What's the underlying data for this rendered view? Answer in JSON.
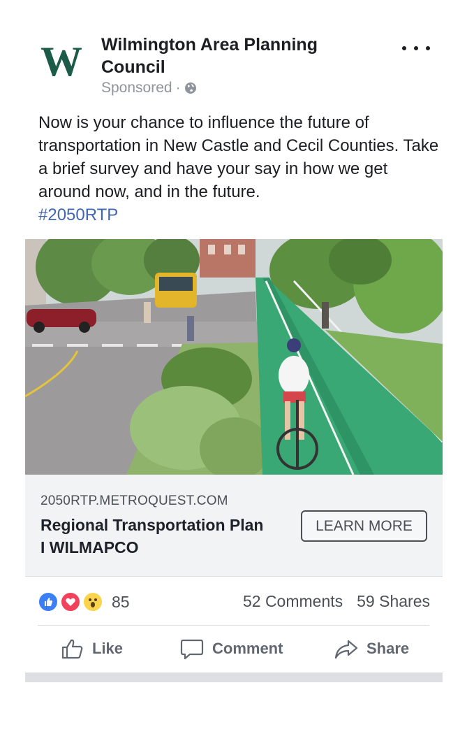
{
  "post": {
    "page_name": "Wilmington Area Planning Council",
    "logo_letter": "W",
    "sponsored_label": "Sponsored",
    "separator": "·",
    "body_text": "Now is your chance to influence the future of transportation in New Castle and Cecil Counties. Take a brief survey and have your say in how we get around now, and in the future.",
    "hashtag": "#2050RTP"
  },
  "link_card": {
    "domain": "2050RTP.METROQUEST.COM",
    "title": "Regional Transportation Plan I WILMAPCO",
    "cta_label": "LEARN MORE"
  },
  "engagement": {
    "reaction_count": "85",
    "comments": "52 Comments",
    "shares": "59 Shares",
    "reactions": [
      "like-icon",
      "love-icon",
      "wow-icon"
    ]
  },
  "actions": {
    "like": "Like",
    "comment": "Comment",
    "share": "Share"
  },
  "colors": {
    "brand_green": "#1c5b47",
    "link_blue": "#4267b2",
    "bike_lane_green": "#3aa874"
  }
}
